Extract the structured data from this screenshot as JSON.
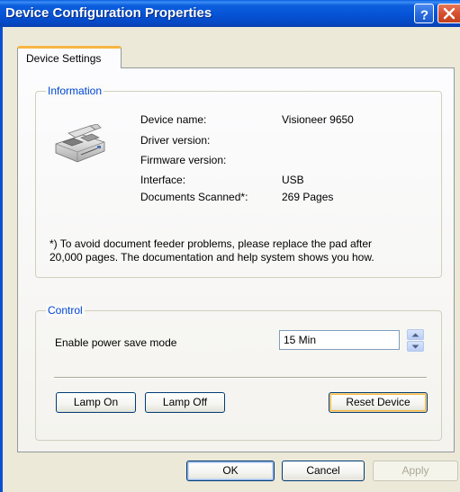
{
  "window": {
    "title": "Device Configuration Properties"
  },
  "tabs": [
    {
      "label": "Device Settings",
      "active": true
    }
  ],
  "information": {
    "legend": "Information",
    "fields": [
      {
        "label": "Device name:",
        "value": "Visioneer 9650"
      },
      {
        "label": "Driver version:",
        "value": ""
      },
      {
        "label": "Firmware version:",
        "value": ""
      },
      {
        "label": "Interface:",
        "value": "USB"
      },
      {
        "label": "Documents Scanned*:",
        "value": "269 Pages"
      }
    ],
    "note_line1": "*)  To avoid document feeder problems, please replace the pad after",
    "note_line2": "20,000 pages. The documentation and help system shows you how."
  },
  "control": {
    "legend": "Control",
    "power_save_label": "Enable power save mode",
    "power_save_value": "15 Min",
    "lamp_on_label": "Lamp On",
    "lamp_off_label": "Lamp Off",
    "reset_label": "Reset Device"
  },
  "footer": {
    "ok_label": "OK",
    "cancel_label": "Cancel",
    "apply_label": "Apply"
  },
  "icons": {
    "help": "help-icon",
    "close": "close-icon",
    "scanner": "scanner-icon",
    "spin_up": "spin-up-icon",
    "spin_down": "spin-down-icon"
  },
  "colors": {
    "titlebar": "#0553d6",
    "tab_highlight": "#f7b543",
    "legend_text": "#0046d5",
    "close_button": "#d6502f"
  }
}
